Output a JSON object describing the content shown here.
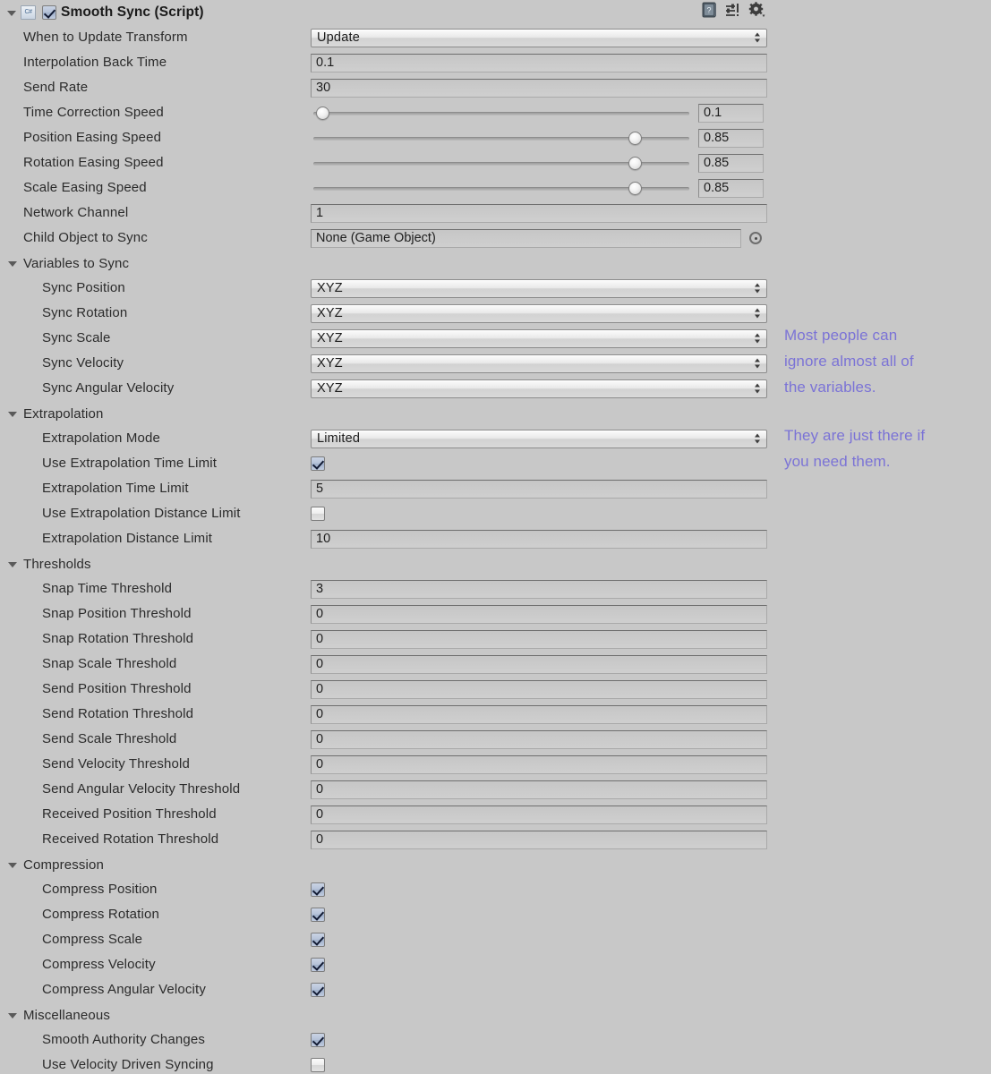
{
  "component": {
    "title": "Smooth Sync (Script)",
    "enabled": true,
    "script_icon_label": "C#",
    "icons": {
      "help": "help-icon",
      "preset": "preset-icon",
      "gear": "gear-icon"
    }
  },
  "top_fields": [
    {
      "label": "When to Update Transform",
      "type": "dropdown",
      "value": "Update"
    },
    {
      "label": "Interpolation Back Time",
      "type": "text",
      "value": "0.1"
    },
    {
      "label": "Send Rate",
      "type": "text",
      "value": "30"
    },
    {
      "label": "Time Correction Speed",
      "type": "slider",
      "value": "0.1",
      "fill": 3
    },
    {
      "label": "Position Easing Speed",
      "type": "slider",
      "value": "0.85",
      "fill": 85
    },
    {
      "label": "Rotation Easing Speed",
      "type": "slider",
      "value": "0.85",
      "fill": 85
    },
    {
      "label": "Scale Easing Speed",
      "type": "slider",
      "value": "0.85",
      "fill": 85
    },
    {
      "label": "Network Channel",
      "type": "text",
      "value": "1"
    },
    {
      "label": "Child Object to Sync",
      "type": "object",
      "value": "None (Game Object)"
    }
  ],
  "sections": [
    {
      "title": "Variables to Sync",
      "expanded": true,
      "rows": [
        {
          "label": "Sync Position",
          "type": "dropdown",
          "value": "XYZ"
        },
        {
          "label": "Sync Rotation",
          "type": "dropdown",
          "value": "XYZ"
        },
        {
          "label": "Sync Scale",
          "type": "dropdown",
          "value": "XYZ"
        },
        {
          "label": "Sync Velocity",
          "type": "dropdown",
          "value": "XYZ"
        },
        {
          "label": "Sync Angular Velocity",
          "type": "dropdown",
          "value": "XYZ"
        }
      ]
    },
    {
      "title": "Extrapolation",
      "expanded": true,
      "rows": [
        {
          "label": "Extrapolation Mode",
          "type": "dropdown",
          "value": "Limited"
        },
        {
          "label": "Use Extrapolation Time Limit",
          "type": "checkbox",
          "checked": true
        },
        {
          "label": "Extrapolation Time Limit",
          "type": "text",
          "value": "5"
        },
        {
          "label": "Use Extrapolation Distance Limit",
          "type": "checkbox",
          "checked": false
        },
        {
          "label": "Extrapolation Distance Limit",
          "type": "text",
          "value": "10"
        }
      ]
    },
    {
      "title": "Thresholds",
      "expanded": true,
      "rows": [
        {
          "label": "Snap Time Threshold",
          "type": "text",
          "value": "3"
        },
        {
          "label": "Snap Position Threshold",
          "type": "text",
          "value": "0"
        },
        {
          "label": "Snap Rotation Threshold",
          "type": "text",
          "value": "0"
        },
        {
          "label": "Snap Scale Threshold",
          "type": "text",
          "value": "0"
        },
        {
          "label": "Send Position Threshold",
          "type": "text",
          "value": "0"
        },
        {
          "label": "Send Rotation Threshold",
          "type": "text",
          "value": "0"
        },
        {
          "label": "Send Scale Threshold",
          "type": "text",
          "value": "0"
        },
        {
          "label": "Send Velocity Threshold",
          "type": "text",
          "value": "0"
        },
        {
          "label": "Send Angular Velocity Threshold",
          "type": "text",
          "value": "0"
        },
        {
          "label": "Received Position Threshold",
          "type": "text",
          "value": "0"
        },
        {
          "label": "Received Rotation Threshold",
          "type": "text",
          "value": "0"
        }
      ]
    },
    {
      "title": "Compression",
      "expanded": true,
      "rows": [
        {
          "label": "Compress Position",
          "type": "checkbox",
          "checked": true
        },
        {
          "label": "Compress Rotation",
          "type": "checkbox",
          "checked": true
        },
        {
          "label": "Compress Scale",
          "type": "checkbox",
          "checked": true
        },
        {
          "label": "Compress Velocity",
          "type": "checkbox",
          "checked": true
        },
        {
          "label": "Compress Angular Velocity",
          "type": "checkbox",
          "checked": true
        }
      ]
    },
    {
      "title": "Miscellaneous",
      "expanded": true,
      "rows": [
        {
          "label": "Smooth Authority Changes",
          "type": "checkbox",
          "checked": true
        },
        {
          "label": "Use Velocity Driven Syncing",
          "type": "checkbox",
          "checked": false
        }
      ]
    }
  ],
  "annotations": [
    {
      "text": "Most people can\nignore almost all of\nthe variables.",
      "color": "#7b73d6"
    },
    {
      "text": "They are just there if\nyou need them.",
      "color": "#7b73d6"
    }
  ]
}
